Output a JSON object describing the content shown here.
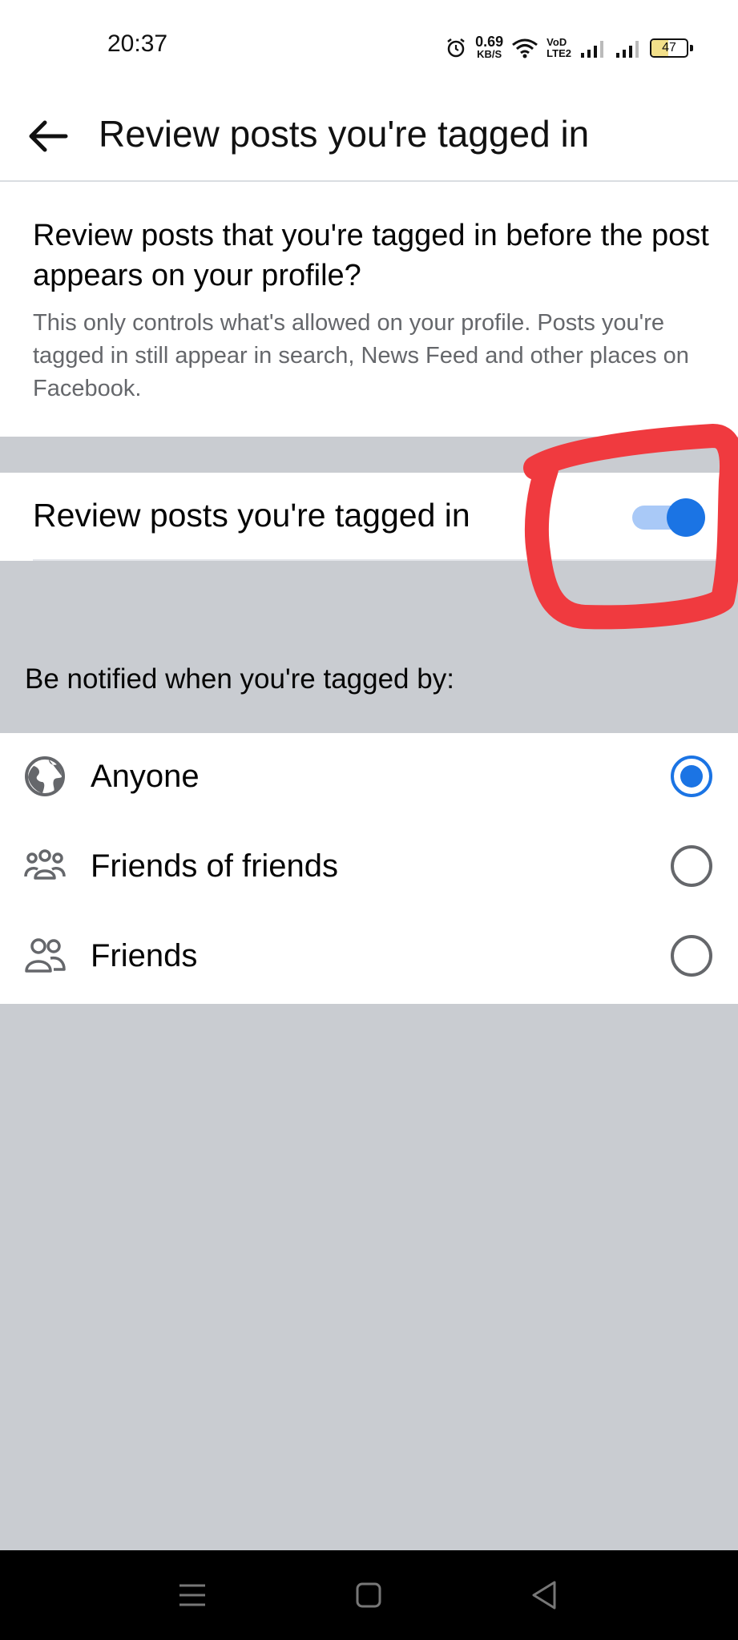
{
  "status_bar": {
    "time": "20:37",
    "net_speed_value": "0.69",
    "net_speed_unit": "KB/S",
    "volte_top": "VoD",
    "volte_bottom": "LTE2",
    "battery_level": "47",
    "battery_fraction": 0.47
  },
  "header": {
    "title": "Review posts you're tagged in",
    "back_icon": "arrow-left-icon"
  },
  "intro": {
    "question": "Review posts that you're tagged in before the post appears on your profile?",
    "note": "This only controls what's allowed on your profile. Posts you're tagged in still appear in search, News Feed and other places on Facebook."
  },
  "toggle": {
    "label": "Review posts you're tagged in",
    "on": true,
    "accent_color": "#1b74e4",
    "track_color": "#a9c9f7"
  },
  "annotation": {
    "color": "#f03a3f",
    "shape": "hand-drawn-circle-around-toggle"
  },
  "notify": {
    "header": "Be notified when you're tagged by:",
    "options": [
      {
        "label": "Anyone",
        "icon": "globe-icon",
        "selected": true
      },
      {
        "label": "Friends of friends",
        "icon": "group-icon",
        "selected": false
      },
      {
        "label": "Friends",
        "icon": "friends-icon",
        "selected": false
      }
    ]
  },
  "colors": {
    "background_gray": "#c9ccd1",
    "secondary_text": "#65676b"
  },
  "nav_bar": {
    "buttons": [
      "menu-icon",
      "home-icon",
      "back-triangle-icon"
    ]
  }
}
